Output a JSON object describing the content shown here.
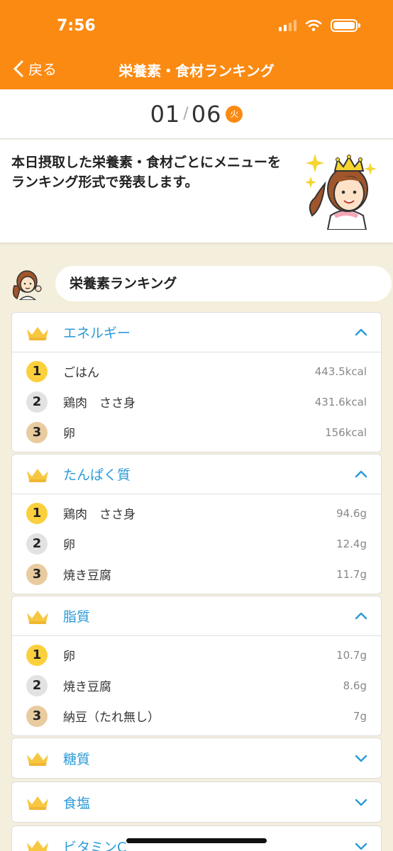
{
  "status_bar": {
    "time": "7:56"
  },
  "nav": {
    "back_label": "戻る",
    "title": "栄養素・食材ランキング"
  },
  "date": {
    "month": "01",
    "separator": "/",
    "day": "06",
    "weekday": "火"
  },
  "intro": {
    "text": "本日摂取した栄養素・食材ごとにメニューをランキング形式で発表します。"
  },
  "section": {
    "title": "栄養素ランキング"
  },
  "colors": {
    "accent": "#fb8a12",
    "link_blue": "#2a9ad8",
    "rank1": "#fbd03c",
    "rank2": "#e2e2e2",
    "rank3": "#e8cb9f",
    "crown": "#f7c740"
  },
  "rankings": [
    {
      "title": "エネルギー",
      "expanded": true,
      "items": [
        {
          "rank": "1",
          "name": "ごはん",
          "value": "443.5kcal"
        },
        {
          "rank": "2",
          "name": "鶏肉　ささ身",
          "value": "431.6kcal"
        },
        {
          "rank": "3",
          "name": "卵",
          "value": "156kcal"
        }
      ]
    },
    {
      "title": "たんぱく質",
      "expanded": true,
      "items": [
        {
          "rank": "1",
          "name": "鶏肉　ささ身",
          "value": "94.6g"
        },
        {
          "rank": "2",
          "name": "卵",
          "value": "12.4g"
        },
        {
          "rank": "3",
          "name": "焼き豆腐",
          "value": "11.7g"
        }
      ]
    },
    {
      "title": "脂質",
      "expanded": true,
      "items": [
        {
          "rank": "1",
          "name": "卵",
          "value": "10.7g"
        },
        {
          "rank": "2",
          "name": "焼き豆腐",
          "value": "8.6g"
        },
        {
          "rank": "3",
          "name": "納豆（たれ無し）",
          "value": "7g"
        }
      ]
    },
    {
      "title": "糖質",
      "expanded": false
    },
    {
      "title": "食塩",
      "expanded": false
    },
    {
      "title": "ビタミンC",
      "expanded": false
    }
  ]
}
